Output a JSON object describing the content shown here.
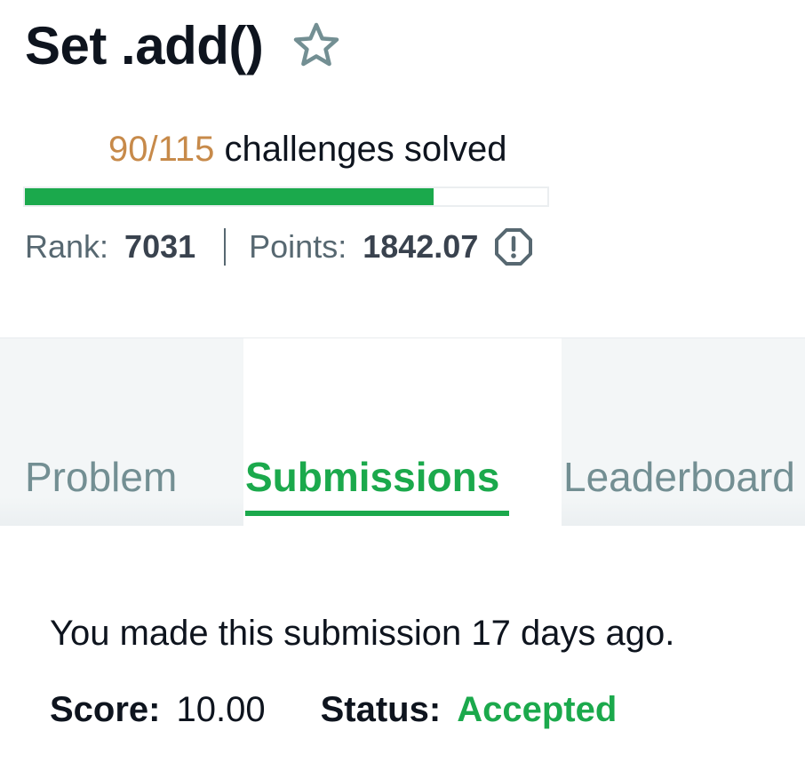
{
  "header": {
    "title": "Set .add()",
    "star_icon": "star-outline-icon",
    "progress": {
      "count": "90/115",
      "label": " challenges solved",
      "solved": 90,
      "total": 115,
      "fill_color": "#1ba94c",
      "count_color": "#c78a4a"
    },
    "stats": {
      "rank_label": "Rank:",
      "rank_value": "7031",
      "points_label": "Points:",
      "points_value": "1842.07",
      "info_icon": "exclamation-circle-icon"
    }
  },
  "tabs": [
    {
      "label": "Problem",
      "active": false
    },
    {
      "label": "Submissions",
      "active": true
    },
    {
      "label": "Leaderboard",
      "active": false
    }
  ],
  "submission": {
    "message": "You made this submission 17 days ago.",
    "score_label": "Score:",
    "score_value": "10.00",
    "status_label": "Status:",
    "status_value": "Accepted",
    "status_color": "#1ba94c"
  }
}
